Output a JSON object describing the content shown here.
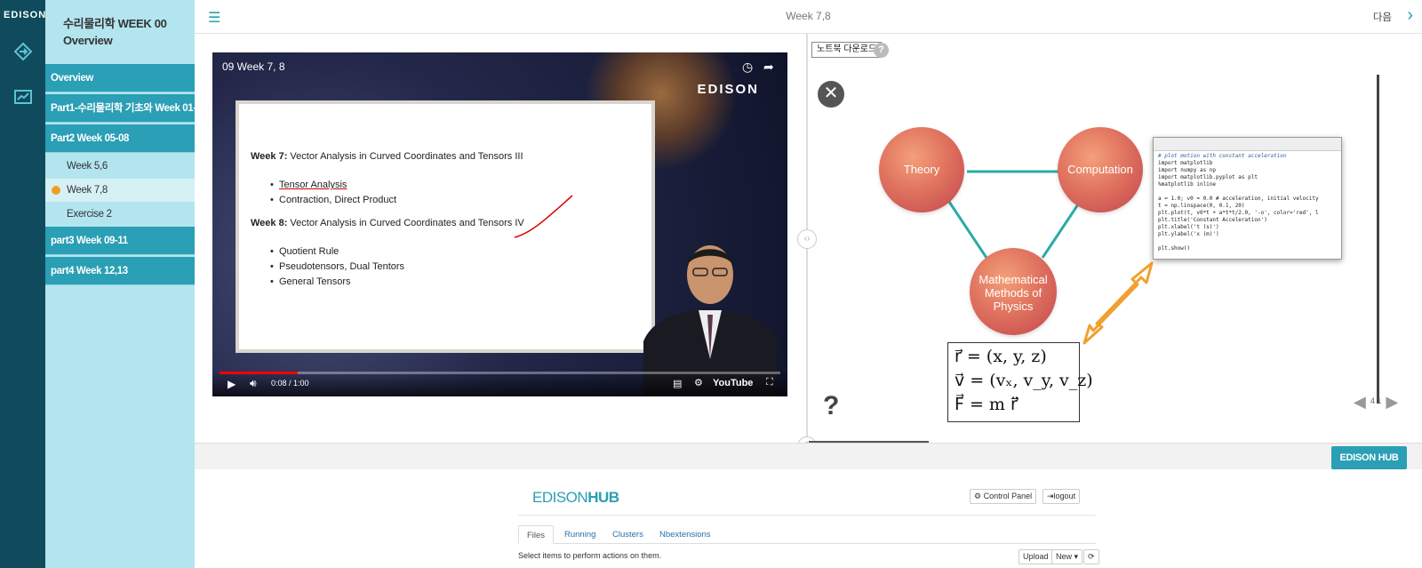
{
  "app": {
    "logo_text": "EDISON"
  },
  "nav": {
    "title": "수리물리학 WEEK 00 Overview",
    "sections": [
      {
        "label": "Overview"
      },
      {
        "label": "Part1-수리물리학 기초와 Week 01-04"
      },
      {
        "label": "Part2 Week 05-08"
      },
      {
        "label": "part3 Week 09-11"
      },
      {
        "label": "part4 Week 12,13"
      }
    ],
    "subitems": [
      {
        "label": "Week 5,6"
      },
      {
        "label": "Week 7,8"
      },
      {
        "label": "Exercise 2"
      }
    ]
  },
  "topbar": {
    "title": "Week 7,8",
    "next_label": "다음"
  },
  "video": {
    "title": "09 Week 7, 8",
    "logo_text": "EDISON",
    "time": "0:08 / 1:00",
    "progress": 0.14,
    "youtube_label": "YouTube",
    "slide": {
      "week7_bold": "Week 7:",
      "week7_rest": " Vector Analysis in Curved Coordinates and Tensors III",
      "week7_items": [
        "Tensor Analysis",
        "Contraction, Direct Product"
      ],
      "week8_bold": "Week 8:",
      "week8_rest": " Vector Analysis in Curved Coordinates and Tensors IV",
      "week8_items": [
        "Quotient Rule",
        "Pseudotensors, Dual Tentors",
        "General Tensors"
      ]
    }
  },
  "viewer": {
    "download_label": "노트북 다운로드",
    "help_label": "?",
    "circles": [
      "Theory",
      "Computation",
      "Mathematical Methods of Physics"
    ],
    "code": [
      "# plot motion with constant acceleration",
      "import matplotlib",
      "import numpy as np",
      "import matplotlib.pyplot as plt",
      "%matplotlib inline",
      "",
      "a = 1.0; v0 = 0.0 # acceleration, initial velocity",
      "t = np.linspace(0, 0.1, 20)",
      "plt.plot(t, v0*t + a*t*t/2.0, '-o', color='red', l",
      "plt.title('Constant Acceleration')",
      "plt.xlabel('t (s)')",
      "plt.ylabel('x (m)')",
      "",
      "plt.show()"
    ],
    "math": [
      "r⃗ = (x, y, z)",
      "v⃗ = (vₓ, v_y, v_z)",
      "F⃗ = m r⃗̈"
    ],
    "page": "4 1"
  },
  "hub": {
    "button_label": "EDISON HUB",
    "brand_light": "EDISON",
    "brand_bold": "HUB",
    "control_panel": "Control Panel",
    "logout": "logout",
    "tabs": [
      "Files",
      "Running",
      "Clusters",
      "Nbextensions"
    ],
    "note": "Select items to perform actions on them.",
    "upload": "Upload",
    "new": "New ▾"
  },
  "colors": {
    "accent": "#2a9fb5",
    "rail": "#0f4b5c",
    "nav_bg": "#b3e5ef"
  }
}
